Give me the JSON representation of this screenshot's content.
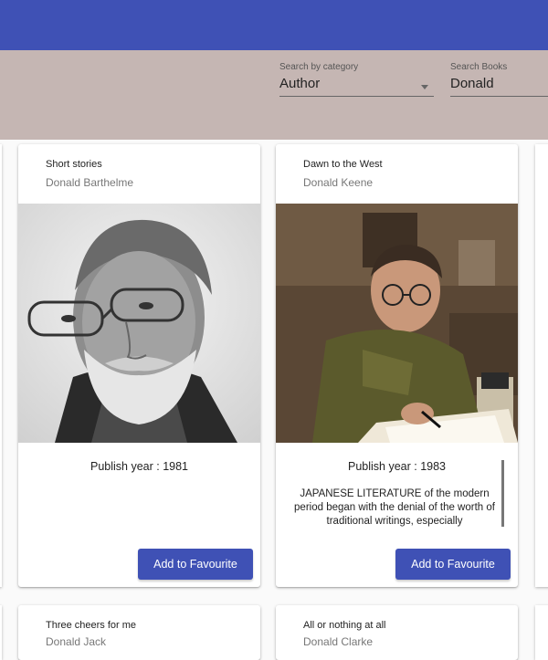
{
  "search": {
    "category_label": "Search by category",
    "category_value": "Author",
    "books_label": "Search Books",
    "books_value": "Donald"
  },
  "books": [
    {
      "title": "Short stories",
      "author": "Donald Barthelme",
      "publish_year": "Publish year : 1981",
      "description": "",
      "button_label": "Add to Favourite"
    },
    {
      "title": "Dawn to the West",
      "author": "Donald Keene",
      "publish_year": "Publish year : 1983",
      "description": "JAPANESE LITERATURE of the modern period began with the denial of the worth of traditional writings, especially",
      "button_label": "Add to Favourite"
    },
    {
      "title": "Three cheers for me",
      "author": "Donald Jack"
    },
    {
      "title": "All or nothing at all",
      "author": "Donald Clarke"
    }
  ],
  "colors": {
    "app_bar": "#3f51b5",
    "search_bar": "#c5b6b3",
    "button": "#3f51b5"
  }
}
